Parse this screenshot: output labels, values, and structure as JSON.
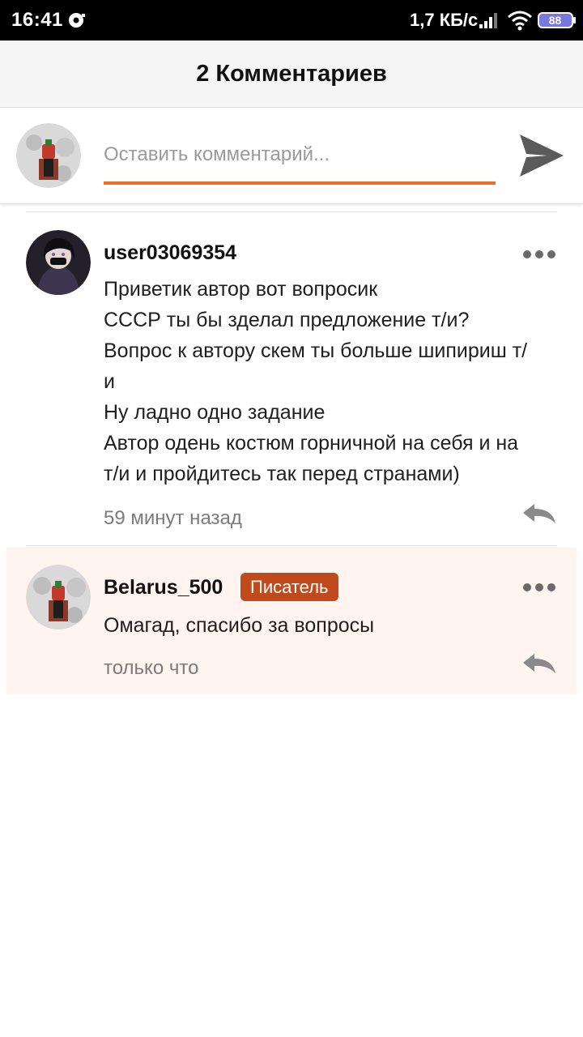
{
  "status_bar": {
    "time": "16:41",
    "network_speed": "1,7 КБ/с",
    "battery": "88",
    "icons": [
      "notification-icon",
      "signal-icon",
      "wifi-icon",
      "battery-icon"
    ]
  },
  "header": {
    "title": "2 Комментариев"
  },
  "composer": {
    "placeholder": "Оставить комментарий...",
    "value": "",
    "send_icon": "send-icon",
    "accent_color": "#e8702a"
  },
  "comments": [
    {
      "username": "user03069354",
      "lines": [
        "Приветик автор вот вопросик",
        "СССР ты бы зделал предложение т/и?",
        "Вопрос к автору скем ты больше шипириш т/",
        "и",
        "Ну ладно одно задание",
        "Автор одень костюм горничной на себя и на",
        "т/и и пройдитесь так перед странами)"
      ],
      "time": "59 минут назад"
    },
    {
      "username": "Belarus_500",
      "badge": "Писатель",
      "badge_color": "#c04a1c",
      "lines": [
        "Омагад, спасибо за вопросы"
      ],
      "time": "только что"
    }
  ]
}
